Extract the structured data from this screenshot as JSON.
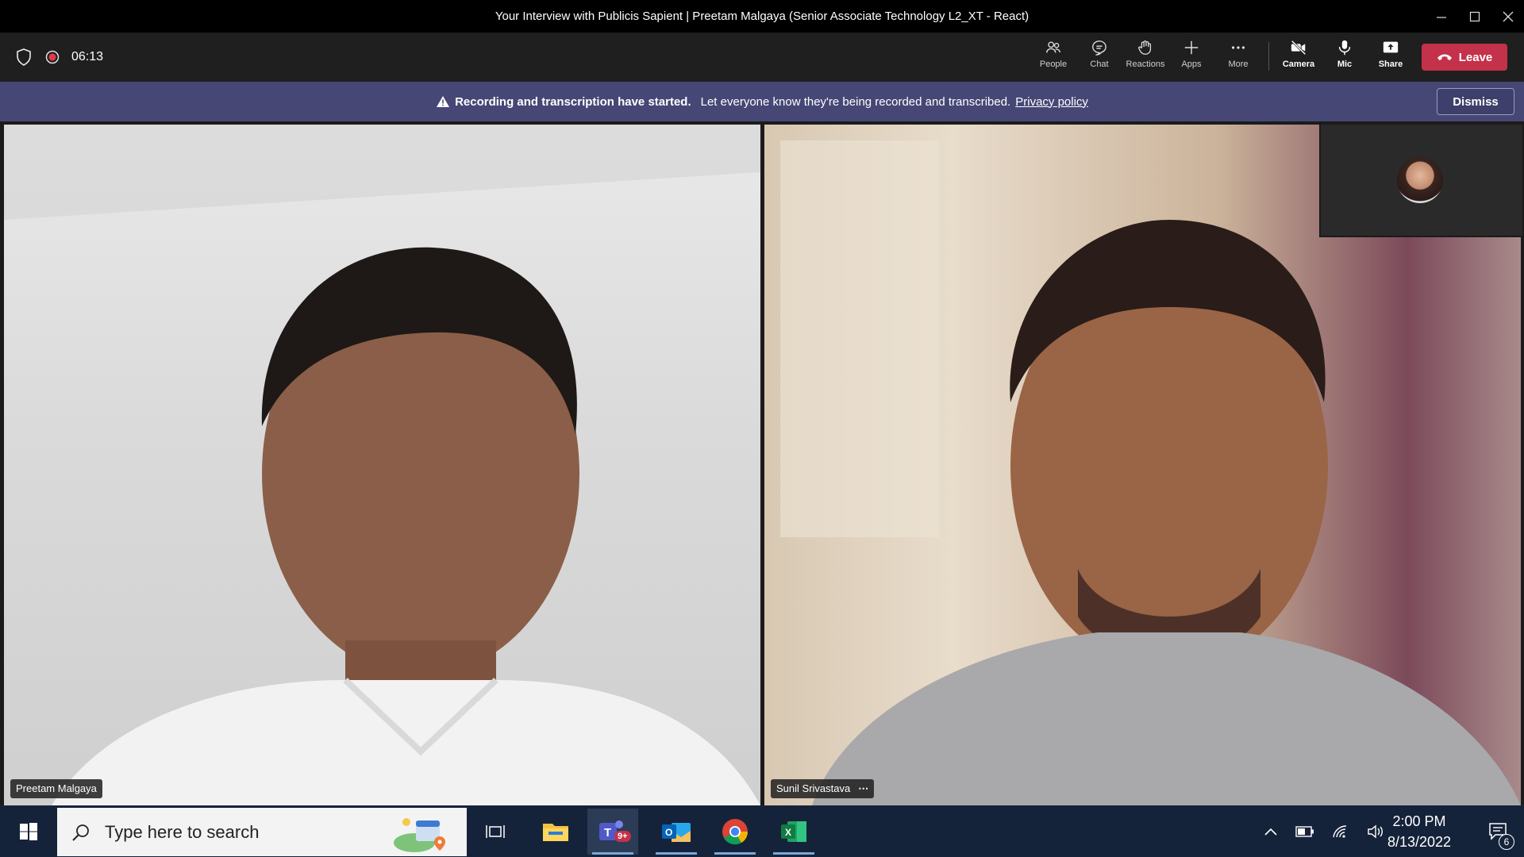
{
  "window": {
    "title": "Your Interview with Publicis Sapient | Preetam Malgaya (Senior Associate Technology L2_XT - React)",
    "controls": [
      "minimize-icon",
      "maximize-icon",
      "close-icon"
    ]
  },
  "toolbar": {
    "timer": "06:13",
    "items": [
      {
        "label": "People",
        "icon": "people-icon"
      },
      {
        "label": "Chat",
        "icon": "chat-icon"
      },
      {
        "label": "Reactions",
        "icon": "reactions-icon"
      },
      {
        "label": "Apps",
        "icon": "plus-icon"
      },
      {
        "label": "More",
        "icon": "ellipsis-icon"
      },
      {
        "label": "Camera",
        "icon": "camera-off-icon"
      },
      {
        "label": "Mic",
        "icon": "mic-icon"
      },
      {
        "label": "Share",
        "icon": "share-icon"
      }
    ],
    "leave_label": "Leave"
  },
  "banner": {
    "title": "Recording and transcription have started.",
    "message": "Let everyone know they're being recorded and transcribed.",
    "link": "Privacy policy",
    "dismiss_label": "Dismiss"
  },
  "participants": {
    "left_name": "Preetam Malgaya",
    "right_name": "Sunil Srivastava",
    "right_more": "⋯"
  },
  "taskbar": {
    "search_placeholder": "Type here to search",
    "time": "2:00 PM",
    "date": "8/13/2022",
    "teams_badge": "9+",
    "notifications_count": "6"
  },
  "colors": {
    "leave": "#c4314b",
    "banner": "#464775",
    "taskbar": "#15233a"
  }
}
